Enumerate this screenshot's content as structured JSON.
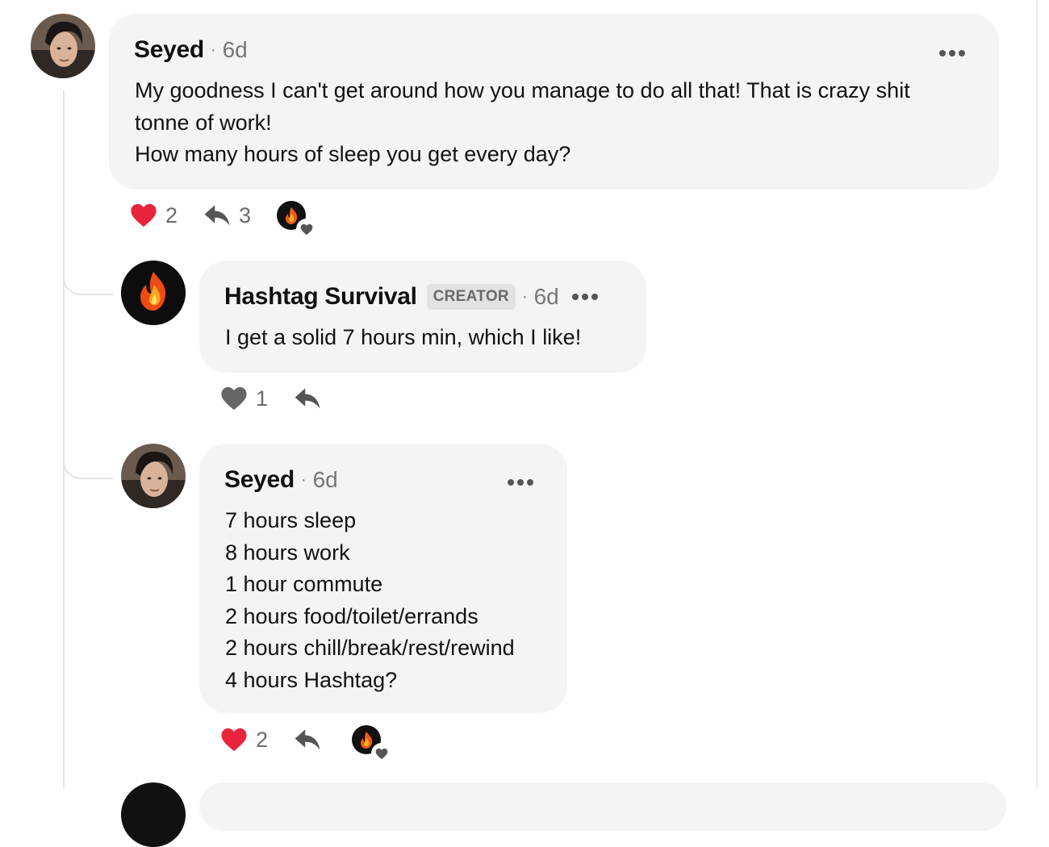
{
  "comments": [
    {
      "author": "Seyed",
      "time": "6d",
      "lines": [
        "My goodness I can't get around how you manage to do all that! That is crazy shit",
        "tonne of work!",
        "How many hours of sleep you get every day?"
      ],
      "likes": "2",
      "replies": "3",
      "liked": true,
      "avatar": "user-avatar-photo"
    },
    {
      "author": "Hashtag Survival",
      "badge": "CREATOR",
      "time": "6d",
      "lines": [
        "I get a solid 7 hours min, which I like!"
      ],
      "likes": "1",
      "liked": false,
      "avatar": "flame-avatar"
    },
    {
      "author": "Seyed",
      "time": "6d",
      "lines": [
        "7 hours sleep",
        "8 hours work",
        "1 hour commute",
        "2 hours food/toilet/errands",
        "2 hours chill/break/rest/rewind",
        "4 hours Hashtag?"
      ],
      "likes": "2",
      "liked": true,
      "avatar": "user-avatar-photo"
    }
  ],
  "icons": {
    "like": "heart-icon",
    "reply": "reply-arrow-icon",
    "more": "more-dots-icon",
    "creator_like": "creator-liked-badge"
  },
  "colors": {
    "liked_heart": "#e8243c",
    "unliked_heart": "#666666",
    "bubble": "#f4f4f4",
    "muted_text": "#777777"
  }
}
